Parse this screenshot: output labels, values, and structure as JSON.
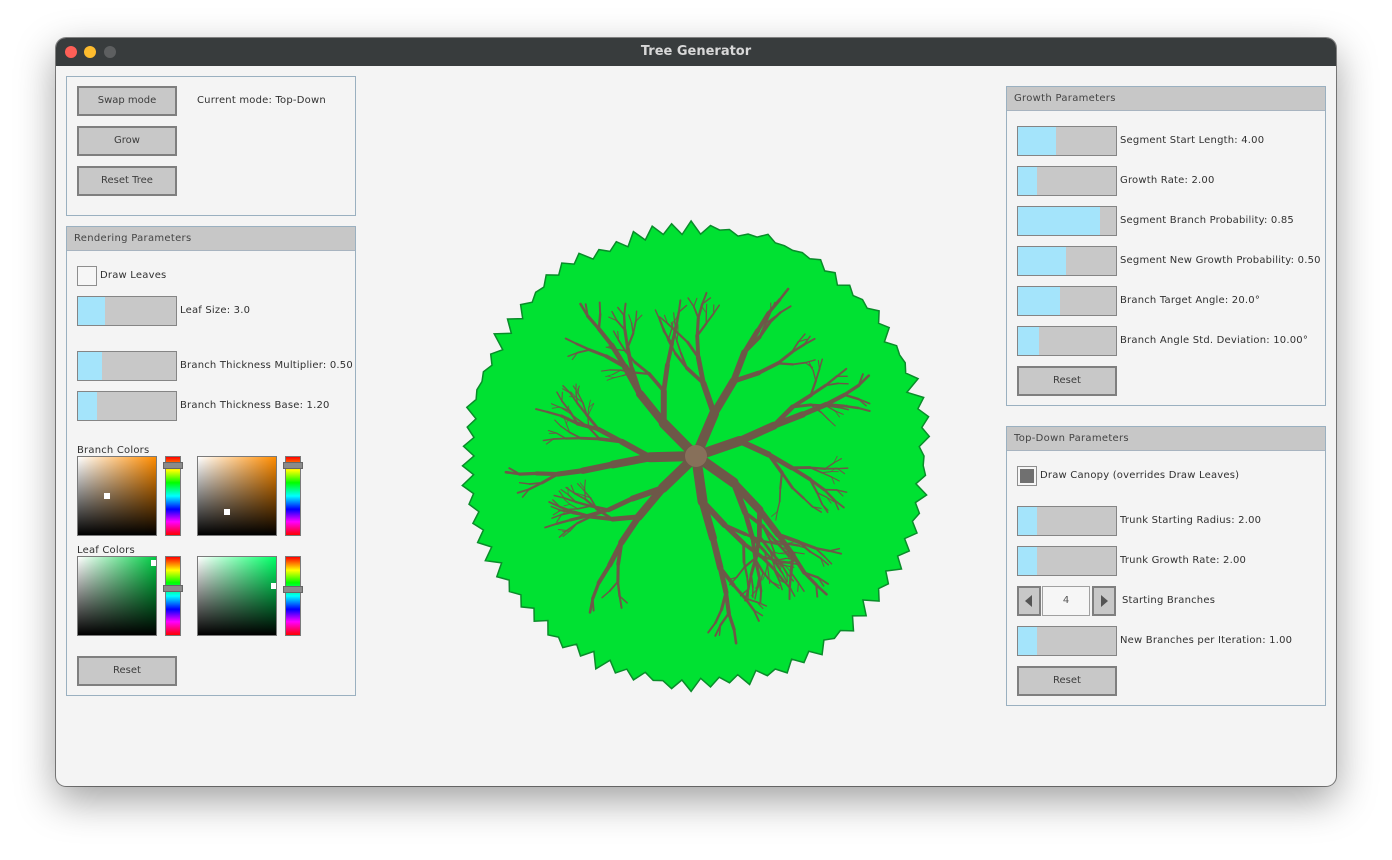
{
  "window": {
    "title": "Tree Generator"
  },
  "mode_panel": {
    "swap_label": "Swap mode",
    "current_mode": "Current mode: Top-Down",
    "grow_label": "Grow",
    "reset_tree_label": "Reset Tree"
  },
  "rendering": {
    "header": "Rendering Parameters",
    "draw_leaves": {
      "label": "Draw Leaves",
      "checked": false
    },
    "sliders": [
      {
        "label": "Leaf Size: 3.0",
        "fraction": 0.28
      },
      {
        "label": "Branch Thickness Multiplier: 0.50",
        "fraction": 0.24
      },
      {
        "label": "Branch Thickness Base: 1.20",
        "fraction": 0.19
      }
    ],
    "branch_colors_label": "Branch Colors",
    "leaf_colors_label": "Leaf Colors",
    "reset_label": "Reset",
    "color_pickers": [
      {
        "hue_color": "#ff8c00",
        "sat": 0.37,
        "val": 0.5,
        "hue_pos": 0.06
      },
      {
        "hue_color": "#ff8c00",
        "sat": 0.37,
        "val": 0.3,
        "hue_pos": 0.06
      },
      {
        "hue_color": "#00cc44",
        "sat": 0.97,
        "val": 0.92,
        "hue_pos": 0.36
      },
      {
        "hue_color": "#00ff66",
        "sat": 0.97,
        "val": 0.63,
        "hue_pos": 0.37
      }
    ]
  },
  "growth": {
    "header": "Growth Parameters",
    "sliders": [
      {
        "label": "Segment Start Length: 4.00",
        "fraction": 0.39
      },
      {
        "label": "Growth Rate: 2.00",
        "fraction": 0.19
      },
      {
        "label": "Segment Branch Probability: 0.85",
        "fraction": 0.84
      },
      {
        "label": "Segment New Growth Probability: 0.50",
        "fraction": 0.49
      },
      {
        "label": "Branch Target Angle: 20.0°",
        "fraction": 0.43
      },
      {
        "label": "Branch Angle Std. Deviation: 10.00°",
        "fraction": 0.21
      }
    ],
    "reset_label": "Reset"
  },
  "topdown": {
    "header": "Top-Down Parameters",
    "draw_canopy": {
      "label": "Draw Canopy (overrides Draw Leaves)",
      "checked": true
    },
    "sliders": [
      {
        "label": "Trunk Starting Radius: 2.00",
        "fraction": 0.19
      },
      {
        "label": "Trunk Growth Rate: 2.00",
        "fraction": 0.19
      }
    ],
    "starting_branches": {
      "value": "4",
      "label": "Starting Branches"
    },
    "new_branches": {
      "label": "New Branches per Iteration: 1.00",
      "fraction": 0.19
    },
    "reset_label": "Reset"
  },
  "canvas": {
    "canopy_color": "#00e132",
    "canopy_outline": "#0a8c2a",
    "branch_color": "#6d5848",
    "trunk_color": "#87705a",
    "background": "#f4f4f4"
  }
}
